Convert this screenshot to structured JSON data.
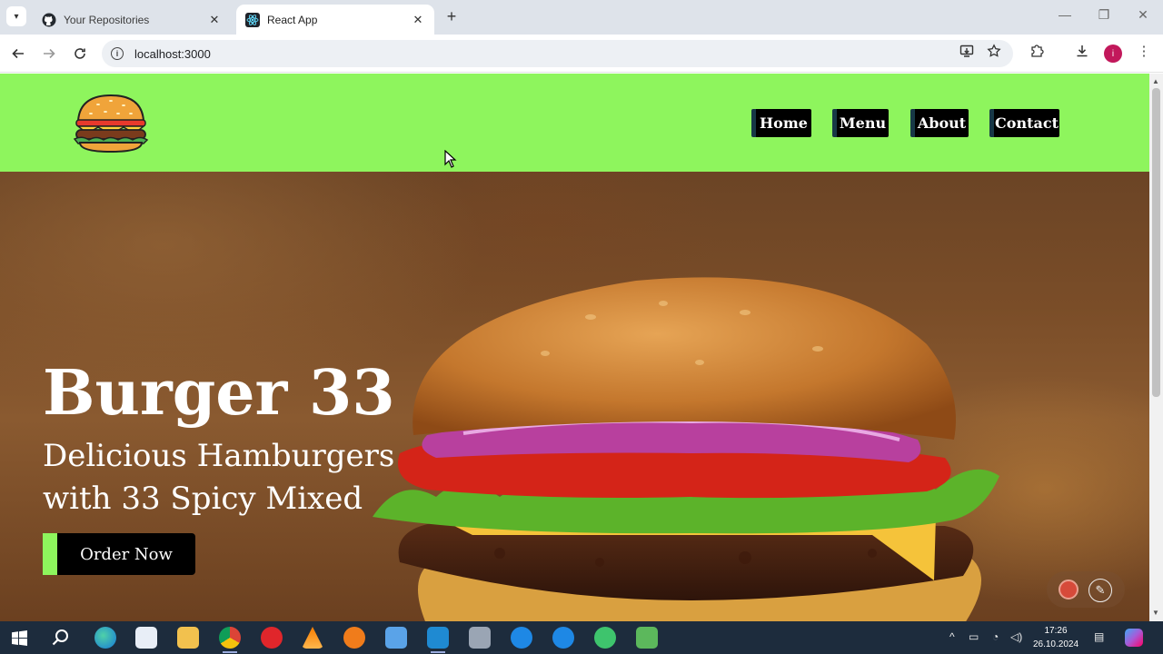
{
  "browser": {
    "tabs": [
      {
        "title": "Your Repositories",
        "active": false
      },
      {
        "title": "React App",
        "active": true
      }
    ],
    "url": "localhost:3000"
  },
  "site": {
    "nav": [
      "Home",
      "Menu",
      "About",
      "Contact"
    ],
    "hero_title": "Burger 33",
    "hero_subtitle": "Delicious Hamburgers with 33 Spicy Mixed",
    "cta": "Order Now",
    "colors": {
      "header_green": "#8ef55d",
      "button_black": "#000000"
    }
  },
  "taskbar": {
    "time": "17:26",
    "date": "26.10.2024"
  }
}
